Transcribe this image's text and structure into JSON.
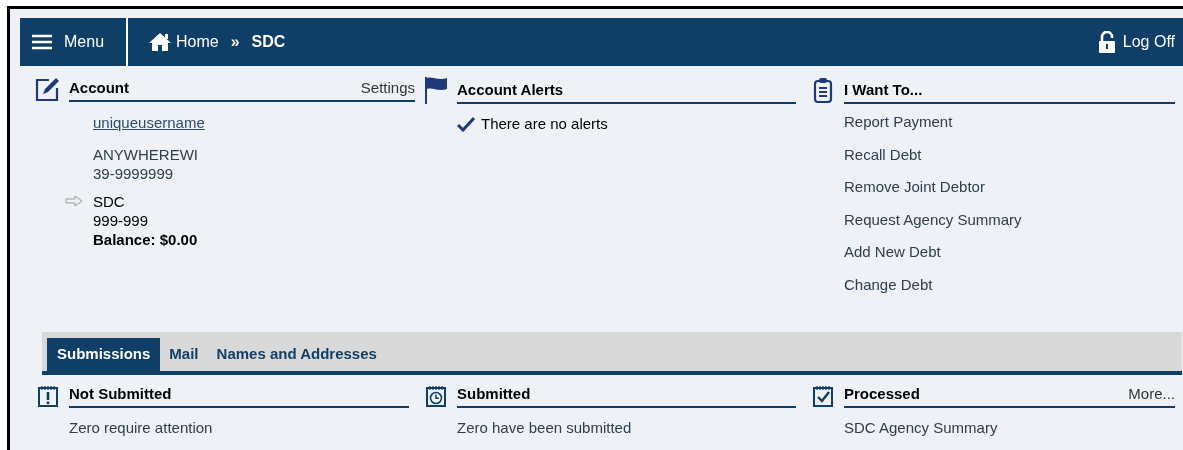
{
  "header": {
    "menu_label": "Menu",
    "breadcrumbs": [
      {
        "label": "Home",
        "kind": "home"
      },
      {
        "label": "SDC",
        "kind": "current"
      }
    ],
    "separator": "»",
    "logoff_label": "Log Off"
  },
  "account": {
    "title": "Account",
    "settings_link": "Settings",
    "username": "uniqueusername",
    "org_lines": [
      "ANYWHEREWI",
      "39-9999999"
    ],
    "debtor": {
      "name": "SDC",
      "number": "999-999",
      "balance": "Balance: $0.00"
    }
  },
  "alerts": {
    "title": "Account Alerts",
    "messages": [
      "There are no alerts"
    ]
  },
  "i_want_to": {
    "title": "I Want To...",
    "actions": [
      "Report Payment",
      "Recall Debt",
      "Remove Joint Debtor",
      "Request Agency Summary",
      "Add New Debt",
      "Change Debt"
    ]
  },
  "tabs": [
    {
      "label": "Submissions",
      "selected": true
    },
    {
      "label": "Mail",
      "selected": false
    },
    {
      "label": "Names and Addresses",
      "selected": false
    }
  ],
  "panels": [
    {
      "kind": "alert",
      "title": "Not Submitted",
      "text": "Zero require attention"
    },
    {
      "kind": "clock",
      "title": "Submitted",
      "text": "Zero have been submitted"
    },
    {
      "kind": "check",
      "title": "Processed",
      "more": "More...",
      "link": "SDC Agency Summary"
    }
  ]
}
